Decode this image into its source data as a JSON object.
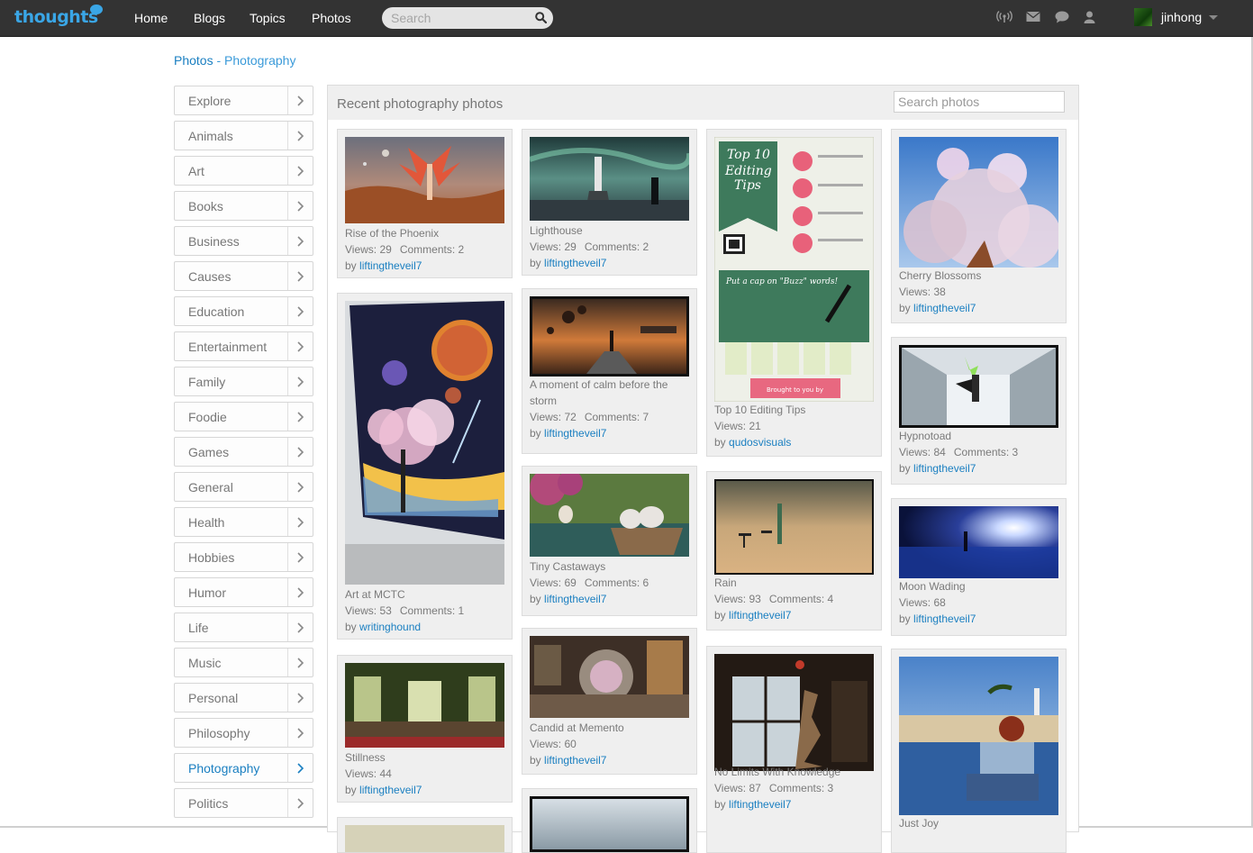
{
  "header": {
    "logo": "thoughts",
    "nav": [
      "Home",
      "Blogs",
      "Topics",
      "Photos"
    ],
    "search_placeholder": "Search",
    "username": "jinhong"
  },
  "breadcrumb": {
    "root": "Photos",
    "separator": "-",
    "current": "Photography"
  },
  "sidebar": {
    "items": [
      "Explore",
      "Animals",
      "Art",
      "Books",
      "Business",
      "Causes",
      "Education",
      "Entertainment",
      "Family",
      "Foodie",
      "Games",
      "General",
      "Health",
      "Hobbies",
      "Humor",
      "Life",
      "Music",
      "Personal",
      "Philosophy",
      "Photography",
      "Politics"
    ],
    "active": "Photography"
  },
  "panel": {
    "title": "Recent photography photos",
    "search_placeholder": "Search photos"
  },
  "photos": [
    {
      "title": "Rise of the Phoenix",
      "views": "Views: 29",
      "comments": "Comments: 2",
      "by": "by",
      "author": "liftingtheveil7"
    },
    {
      "title": "Art at MCTC",
      "views": "Views: 53",
      "comments": "Comments: 1",
      "by": "by",
      "author": "writinghound"
    },
    {
      "title": "Stillness",
      "views": "Views: 44",
      "comments": "",
      "by": "by",
      "author": "liftingtheveil7"
    },
    {
      "title": "Lighthouse",
      "views": "Views: 29",
      "comments": "Comments: 2",
      "by": "by",
      "author": "liftingtheveil7"
    },
    {
      "title": "A moment of calm before the storm",
      "views": "Views: 72",
      "comments": "Comments: 7",
      "by": "by",
      "author": "liftingtheveil7"
    },
    {
      "title": "Tiny Castaways",
      "views": "Views: 69",
      "comments": "Comments: 6",
      "by": "by",
      "author": "liftingtheveil7"
    },
    {
      "title": "Candid at Memento",
      "views": "Views: 60",
      "comments": "",
      "by": "by",
      "author": "liftingtheveil7"
    },
    {
      "title": "Top 10 Editing Tips",
      "views": "Views: 21",
      "comments": "",
      "by": "by",
      "author": "qudosvisuals"
    },
    {
      "title": "Rain",
      "views": "Views: 93",
      "comments": "Comments: 4",
      "by": "by",
      "author": "liftingtheveil7"
    },
    {
      "title": "No Limits With Knowledge",
      "views": "Views: 87",
      "comments": "Comments: 3",
      "by": "by",
      "author": "liftingtheveil7"
    },
    {
      "title": "Cherry Blossoms",
      "views": "Views: 38",
      "comments": "",
      "by": "by",
      "author": "liftingtheveil7"
    },
    {
      "title": "Hypnotoad",
      "views": "Views: 84",
      "comments": "Comments: 3",
      "by": "by",
      "author": "liftingtheveil7"
    },
    {
      "title": "Moon Wading",
      "views": "Views: 68",
      "comments": "",
      "by": "by",
      "author": "liftingtheveil7"
    },
    {
      "title": "Just Joy",
      "views": "",
      "comments": "",
      "by": "",
      "author": ""
    }
  ],
  "poster": {
    "heading": "Top 10 Editing Tips",
    "banner": "Put a cap on \"Buzz\" words!",
    "footer": "Brought to you by"
  },
  "colors": {
    "topbar": "#333333",
    "link": "#1a7fc1",
    "logo": "#3aa6e6"
  }
}
